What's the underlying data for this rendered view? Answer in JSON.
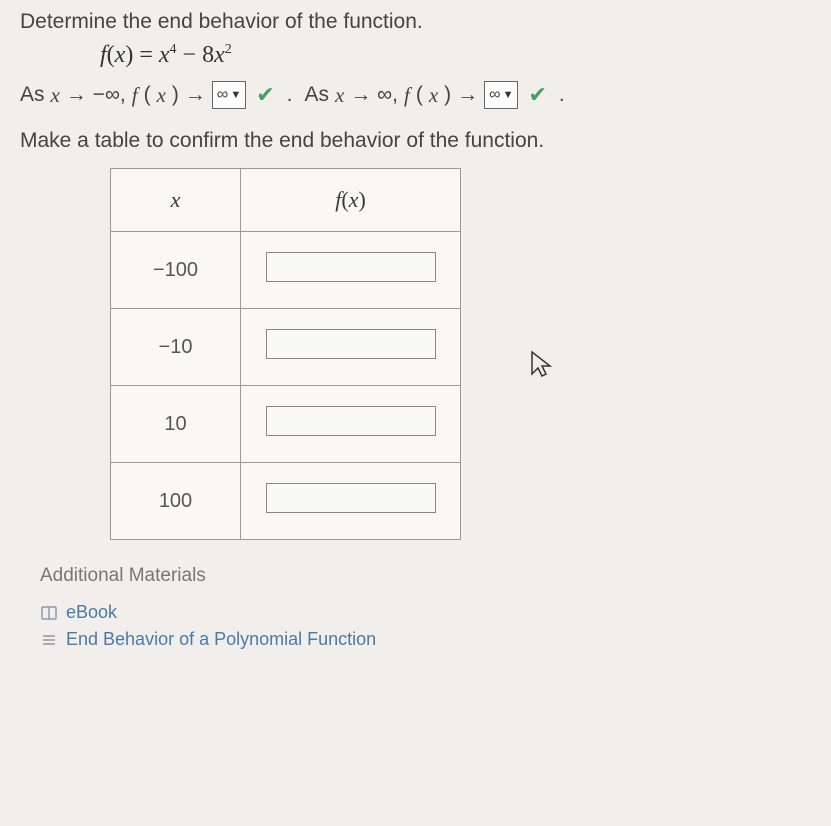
{
  "instruction1": "Determine the end behavior of the function.",
  "equation": {
    "fx": "f",
    "open": "(",
    "x": "x",
    "close": ")",
    "eq": " = ",
    "term1_base": "x",
    "term1_exp": "4",
    "minus": " − 8",
    "term2_base": "x",
    "term2_exp": "2"
  },
  "behavior": {
    "as1": "As ",
    "x1": "x",
    "arrow1": " → −∞, ",
    "fx1": "f",
    "open1": "(",
    "xin1": "x",
    "close1": ")",
    "arrow1b": " → ",
    "sel1": "∞",
    "period": ". ",
    "as2": "As ",
    "x2": "x",
    "arrow2": " → ∞, ",
    "fx2": "f",
    "open2": "(",
    "xin2": "x",
    "close2": ")",
    "arrow2b": " → ",
    "sel2": "∞",
    "period2": "."
  },
  "instruction2": "Make a table to confirm the end behavior of the function.",
  "table": {
    "header_x": "x",
    "header_fx_f": "f",
    "header_fx_open": "(",
    "header_fx_x": "x",
    "header_fx_close": ")",
    "rows": [
      {
        "x": "−100"
      },
      {
        "x": "−10"
      },
      {
        "x": "10"
      },
      {
        "x": "100"
      }
    ]
  },
  "additional": "Additional Materials",
  "links": {
    "ebook": "eBook",
    "endbehavior": "End Behavior of a Polynomial Function"
  }
}
